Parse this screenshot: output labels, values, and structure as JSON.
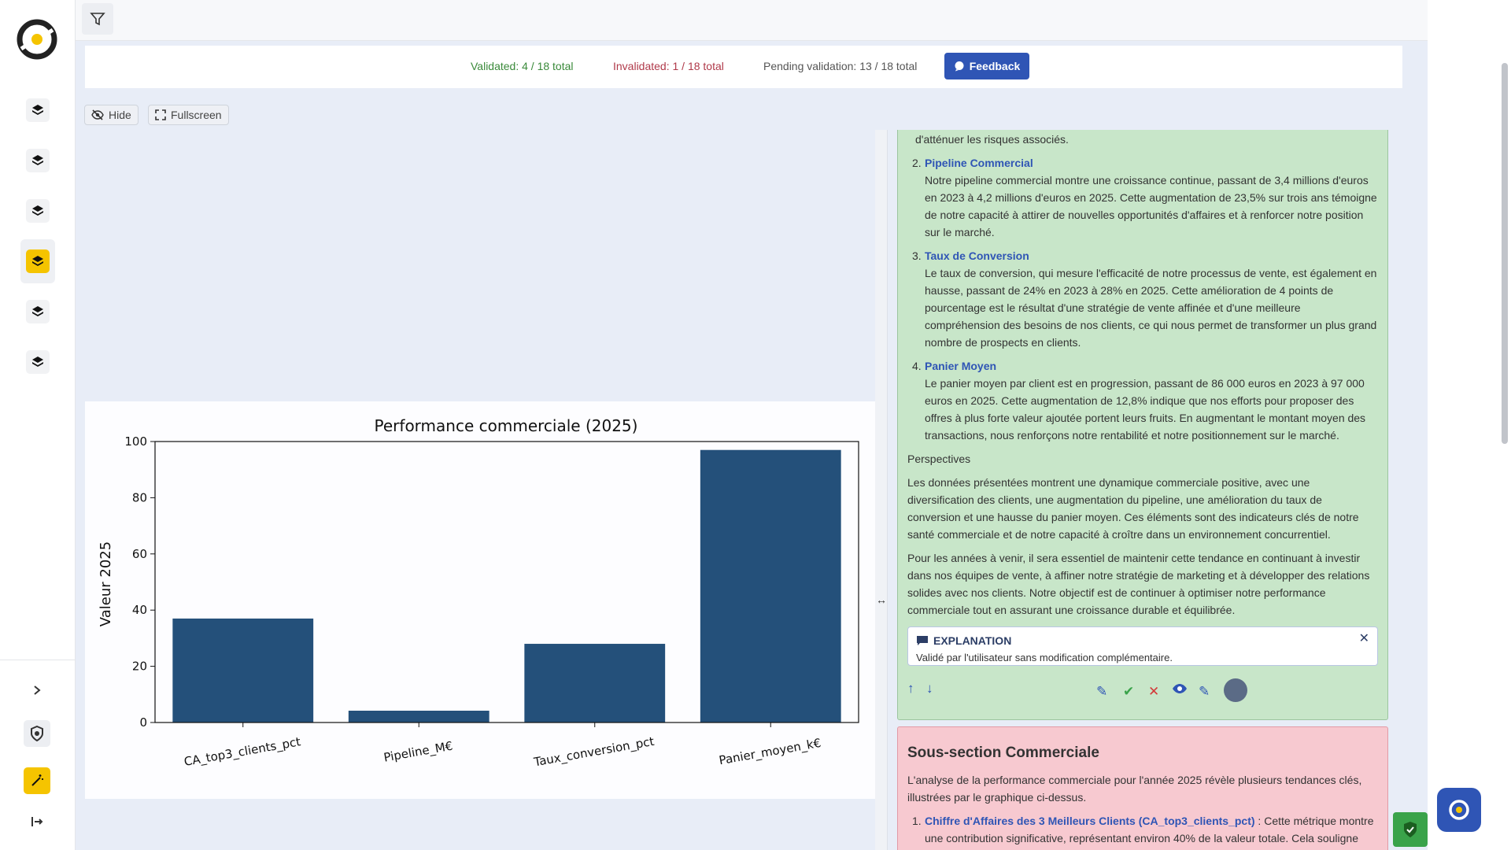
{
  "status": {
    "validated": "Validated: 4 / 18 total",
    "invalidated": "Invalidated: 1 / 18 total",
    "pending": "Pending validation: 13 / 18 total",
    "feedback_label": "Feedback"
  },
  "toolbar": {
    "hide_label": "Hide",
    "fullscreen_label": "Fullscreen"
  },
  "chart_data": {
    "type": "bar",
    "title": "Performance commerciale (2025)",
    "xlabel": "",
    "ylabel": "Valeur 2025",
    "categories": [
      "CA_top3_clients_pct",
      "Pipeline_M€",
      "Taux_conversion_pct",
      "Panier_moyen_k€"
    ],
    "values": [
      37,
      4.2,
      28,
      97
    ],
    "ylim": [
      0,
      100
    ],
    "yticks": [
      0,
      20,
      40,
      60,
      80,
      100
    ],
    "bar_color": "#24507a",
    "grid": false
  },
  "doc": {
    "intro_tail": "d'atténuer les risques associés.",
    "items": [
      {
        "num": "2.",
        "title": "Pipeline Commercial",
        "text": "Notre pipeline commercial montre une croissance continue, passant de 3,4 millions d'euros en 2023 à 4,2 millions d'euros en 2025. Cette augmentation de 23,5% sur trois ans témoigne de notre capacité à attirer de nouvelles opportunités d'affaires et à renforcer notre position sur le marché."
      },
      {
        "num": "3.",
        "title": "Taux de Conversion",
        "text": "Le taux de conversion, qui mesure l'efficacité de notre processus de vente, est également en hausse, passant de 24% en 2023 à 28% en 2025. Cette amélioration de 4 points de pourcentage est le résultat d'une stratégie de vente affinée et d'une meilleure compréhension des besoins de nos clients, ce qui nous permet de transformer un plus grand nombre de prospects en clients."
      },
      {
        "num": "4.",
        "title": "Panier Moyen",
        "text": "Le panier moyen par client est en progression, passant de 86 000 euros en 2023 à 97 000 euros en 2025. Cette augmentation de 12,8% indique que nos efforts pour proposer des offres à plus forte valeur ajoutée portent leurs fruits. En augmentant le montant moyen des transactions, nous renforçons notre rentabilité et notre positionnement sur le marché."
      }
    ],
    "perspectives_heading": "Perspectives",
    "para1": "Les données présentées montrent une dynamique commerciale positive, avec une diversification des clients, une augmentation du pipeline, une amélioration du taux de conversion et une hausse du panier moyen. Ces éléments sont des indicateurs clés de notre santé commerciale et de notre capacité à croître dans un environnement concurrentiel.",
    "para2": "Pour les années à venir, il sera essentiel de maintenir cette tendance en continuant à investir dans nos équipes de vente, à affiner notre stratégie de marketing et à développer des relations solides avec nos clients. Notre objectif est de continuer à optimiser notre performance commerciale tout en assurant une croissance durable et équilibrée.",
    "explanation_title": "EXPLANATION",
    "explanation_body": "Validé par l'utilisateur sans modification complémentaire.",
    "next_title": "Sous-section Commerciale",
    "next_para": "L'analyse de la performance commerciale pour l'année 2025 révèle plusieurs tendances clés, illustrées par le graphique ci-dessus.",
    "next_item_title": "Chiffre d'Affaires des 3 Meilleurs Clients (CA_top3_clients_pct)",
    "next_item_text": " : Cette métrique montre une contribution significative, représentant environ 40% de la valeur totale. Cela souligne"
  },
  "colors": {
    "accent": "#2f55b5",
    "validated": "#3a8a3a",
    "invalidated": "#b03a4a",
    "card_validated": "#c8e6c9",
    "card_invalidated": "#f7c9d0",
    "active_nav": "#f5c400"
  }
}
